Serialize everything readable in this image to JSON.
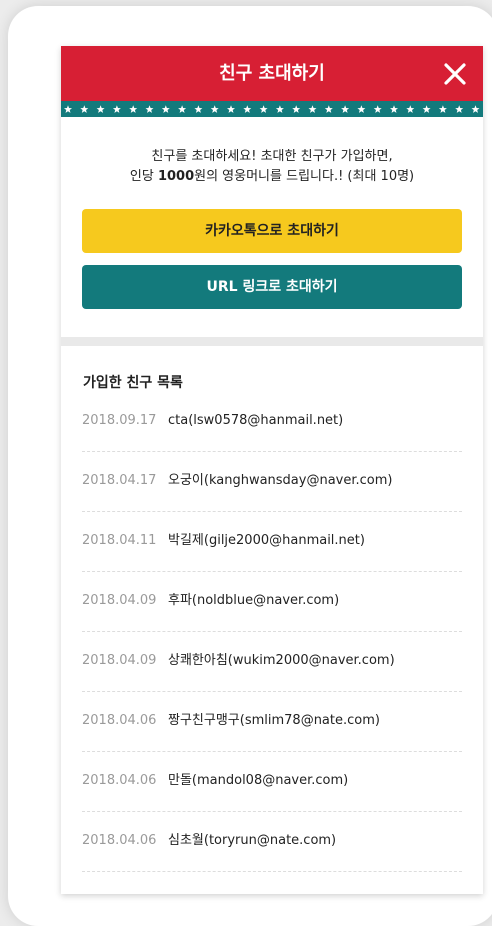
{
  "header": {
    "title": "친구 초대하기",
    "close_icon": "close-x-icon"
  },
  "intro": {
    "line1": "친구를 초대하세요! 초대한 친구가 가입하면,",
    "line2_prefix": "인당 ",
    "line2_bold": "1000",
    "line2_suffix": "원의 영웅머니를 드립니다.! (최대 10명)"
  },
  "buttons": {
    "kakao_label": "카카오톡으로 초대하기",
    "url_label": "URL 링크로 초대하기"
  },
  "friends": {
    "title": "가입한 친구 목록",
    "rows": [
      {
        "date": "2018.09.17",
        "name": "cta(lsw0578@hanmail.net)"
      },
      {
        "date": "2018.04.17",
        "name": "오궁이(kanghwansday@naver.com)"
      },
      {
        "date": "2018.04.11",
        "name": "박길제(gilje2000@hanmail.net)"
      },
      {
        "date": "2018.04.09",
        "name": "후파(noldblue@naver.com)"
      },
      {
        "date": "2018.04.09",
        "name": "상쾌한아침(wukim2000@naver.com)"
      },
      {
        "date": "2018.04.06",
        "name": "짱구친구맹구(smlim78@nate.com)"
      },
      {
        "date": "2018.04.06",
        "name": "만돌(mandol08@naver.com)"
      },
      {
        "date": "2018.04.06",
        "name": "심초월(toryrun@nate.com)"
      }
    ]
  },
  "colors": {
    "header_red": "#d71f34",
    "teal": "#137a7c",
    "kakao_yellow": "#f6c91e"
  }
}
